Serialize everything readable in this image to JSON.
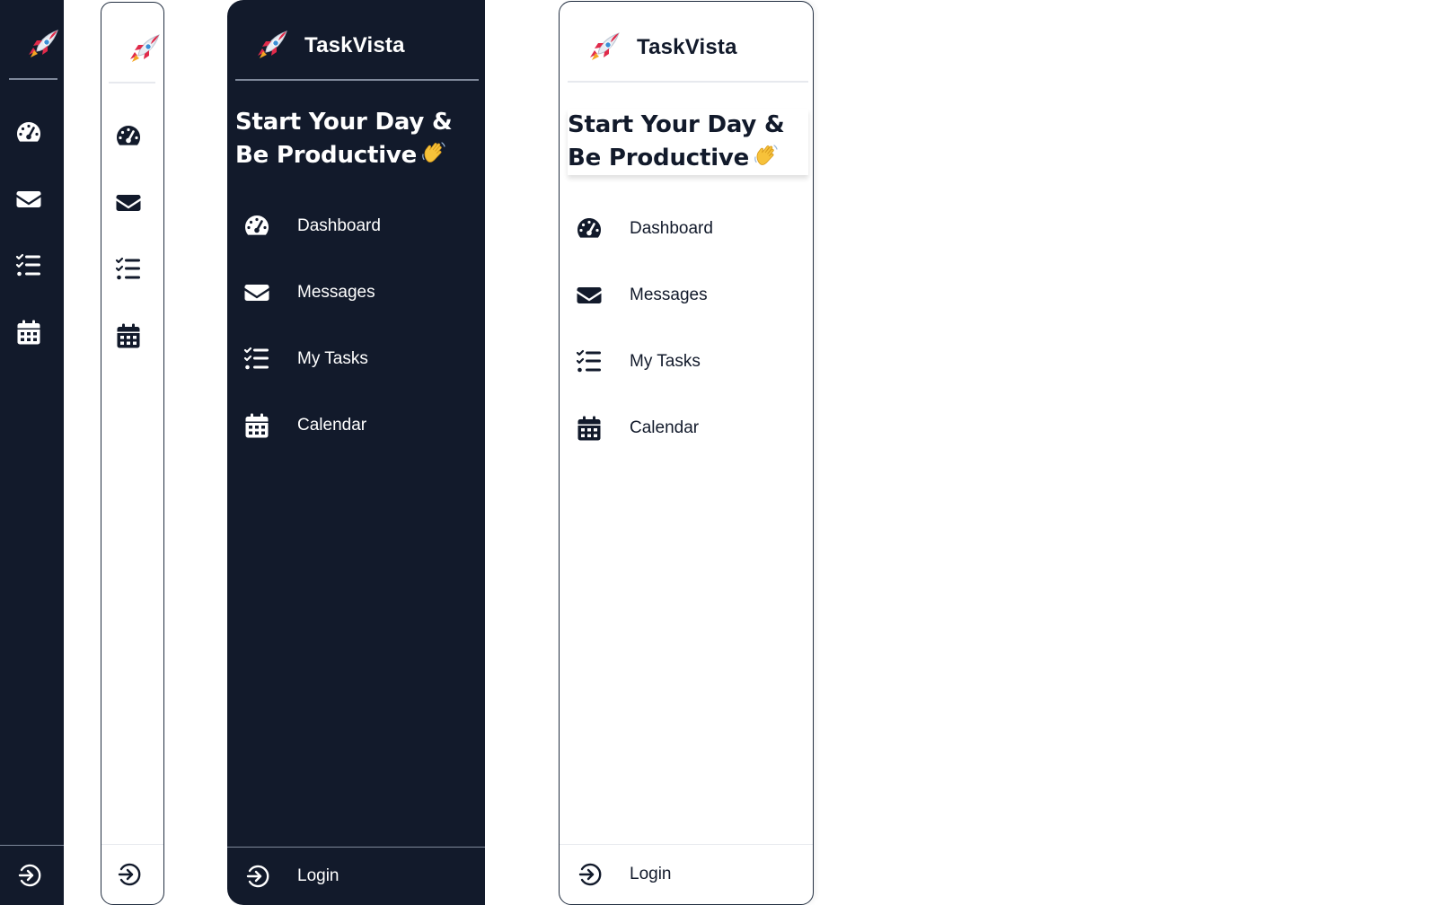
{
  "app": {
    "name": "TaskVista",
    "logo_icon": "rocket-icon"
  },
  "tagline": {
    "text": "Start Your Day & Be Productive",
    "emoji": "waving-hand-icon"
  },
  "nav": {
    "items": [
      {
        "label": "Dashboard",
        "icon": "gauge-icon"
      },
      {
        "label": "Messages",
        "icon": "envelope-icon"
      },
      {
        "label": "My Tasks",
        "icon": "task-list-icon"
      },
      {
        "label": "Calendar",
        "icon": "calendar-icon"
      }
    ]
  },
  "footer": {
    "login_label": "Login",
    "login_icon": "sign-in-icon"
  },
  "colors": {
    "dark_bg": "#121a2b",
    "light_bg": "#ffffff",
    "text_dark": "#121a2b",
    "text_light": "#ffffff",
    "rocket_red": "#e02a4a"
  }
}
